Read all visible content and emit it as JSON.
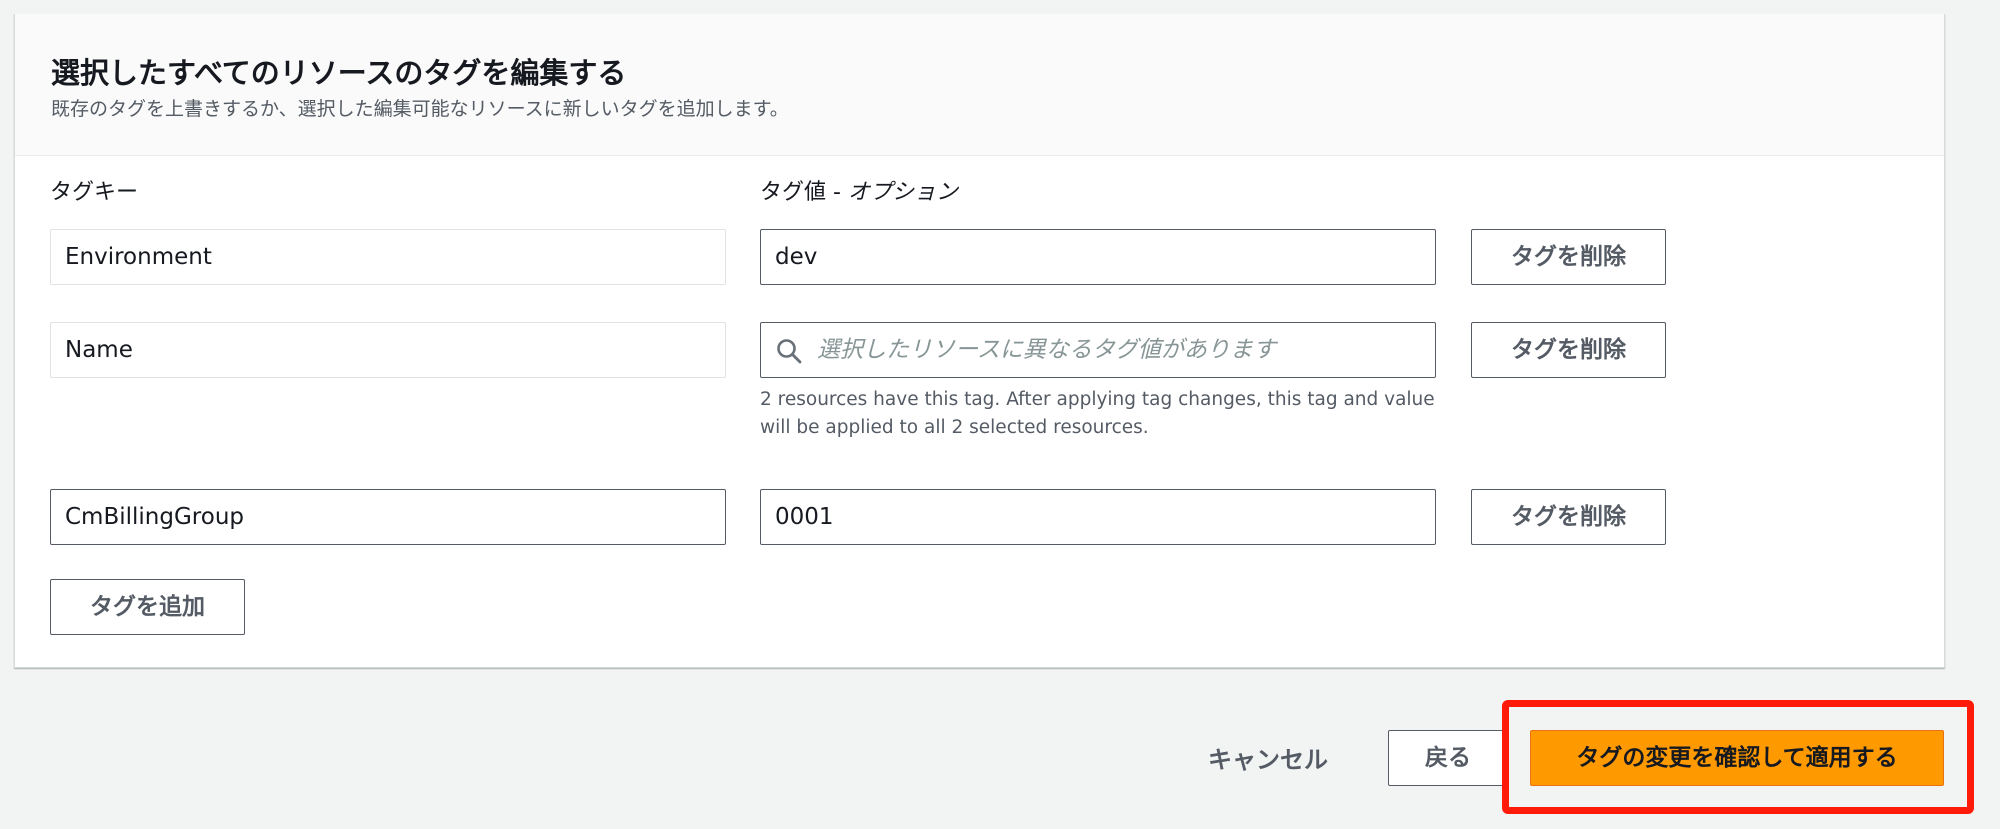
{
  "panel": {
    "title": "選択したすべてのリソースのタグを編集する",
    "description": "既存のタグを上書きするか、選択した編集可能なリソースに新しいタグを追加します。"
  },
  "columns": {
    "key_label": "タグキー",
    "value_label": "タグ値 - ",
    "value_label_optional": "オプション"
  },
  "tags": [
    {
      "key": "Environment",
      "value": "dev",
      "remove_label": "タグを削除"
    },
    {
      "key": "Name",
      "value_placeholder": "選択したリソースに異なるタグ値があります",
      "remove_label": "タグを削除",
      "hint": "2 resources have this tag. After applying tag changes, this tag and value will be applied to all 2 selected resources."
    },
    {
      "key": "CmBillingGroup",
      "value": "0001",
      "remove_label": "タグを削除"
    }
  ],
  "add_tag_label": "タグを追加",
  "footer": {
    "cancel_label": "キャンセル",
    "back_label": "戻る",
    "apply_label": "タグの変更を確認して適用する"
  },
  "icons": {
    "search": "search-icon"
  },
  "colors": {
    "primary": "#ff9900",
    "highlight": "#ff1a0a"
  }
}
